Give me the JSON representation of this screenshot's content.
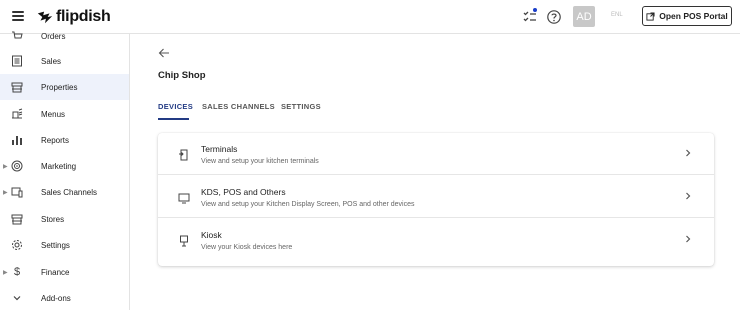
{
  "brand": {
    "name": "flipdish"
  },
  "topbar": {
    "avatar_initials": "AD",
    "language": "ENL",
    "open_pos_label": "Open POS Portal",
    "accent_dot_color": "#1a3ec9"
  },
  "sidebar": {
    "items": [
      {
        "label": "Orders",
        "icon": "cart-icon",
        "expandable": false
      },
      {
        "label": "Sales",
        "icon": "receipt-icon",
        "expandable": false
      },
      {
        "label": "Properties",
        "icon": "storefront-icon",
        "expandable": false,
        "active": true
      },
      {
        "label": "Menus",
        "icon": "menu-book-icon",
        "expandable": false
      },
      {
        "label": "Reports",
        "icon": "bar-chart-icon",
        "expandable": false
      },
      {
        "label": "Marketing",
        "icon": "target-icon",
        "expandable": true
      },
      {
        "label": "Sales Channels",
        "icon": "devices-icon",
        "expandable": true
      },
      {
        "label": "Stores",
        "icon": "store-icon",
        "expandable": false
      },
      {
        "label": "Settings",
        "icon": "gear-icon",
        "expandable": false
      },
      {
        "label": "Finance",
        "icon": "dollar-icon",
        "expandable": true
      },
      {
        "label": "Add-ons",
        "icon": "chevron-down-icon",
        "expandable": false
      }
    ],
    "active_bg": "#eef2fb"
  },
  "main": {
    "title": "Chip Shop",
    "tabs": [
      {
        "label": "DEVICES",
        "active": true
      },
      {
        "label": "SALES CHANNELS",
        "active": false
      },
      {
        "label": "SETTINGS",
        "active": false
      }
    ],
    "tab_accent": "#233b84",
    "devices": [
      {
        "title": "Terminals",
        "description": "View and setup your kitchen terminals",
        "icon": "terminal-icon"
      },
      {
        "title": "KDS, POS and Others",
        "description": "View and setup your Kitchen Display Screen, POS and other devices",
        "icon": "monitor-icon"
      },
      {
        "title": "Kiosk",
        "description": "View your Kiosk devices here",
        "icon": "kiosk-icon"
      }
    ]
  }
}
